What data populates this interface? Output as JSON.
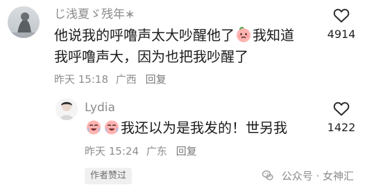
{
  "comments": [
    {
      "username": "じ浅夏ゞ残年∗",
      "text_before_emoji": "他说我的呼噜声太大吵醒他了",
      "text_after_emoji": "我知道我呼噜声大，因为也把我吵醒了",
      "time": "昨天 15:18",
      "location": "广西",
      "reply_label": "回复",
      "like_count": "4914",
      "emoji_name": "sad-peach-emoji"
    },
    {
      "username": "Lydia",
      "text_after_emoji": "我还以为是我发的！世另我",
      "time": "昨天 15:24",
      "location": "广东",
      "reply_label": "回复",
      "like_count": "1422",
      "emoji_name": "crying-laughing-emoji"
    }
  ],
  "badge": {
    "author_liked": "作者赞过"
  },
  "watermark": {
    "text": "公众号 · 女神汇",
    "icon": "wechat-icon"
  },
  "colors": {
    "username": "#8b8b8b",
    "text": "#1b1b1b",
    "meta": "#8d8d8d",
    "badge_bg": "#f0f0f0"
  }
}
